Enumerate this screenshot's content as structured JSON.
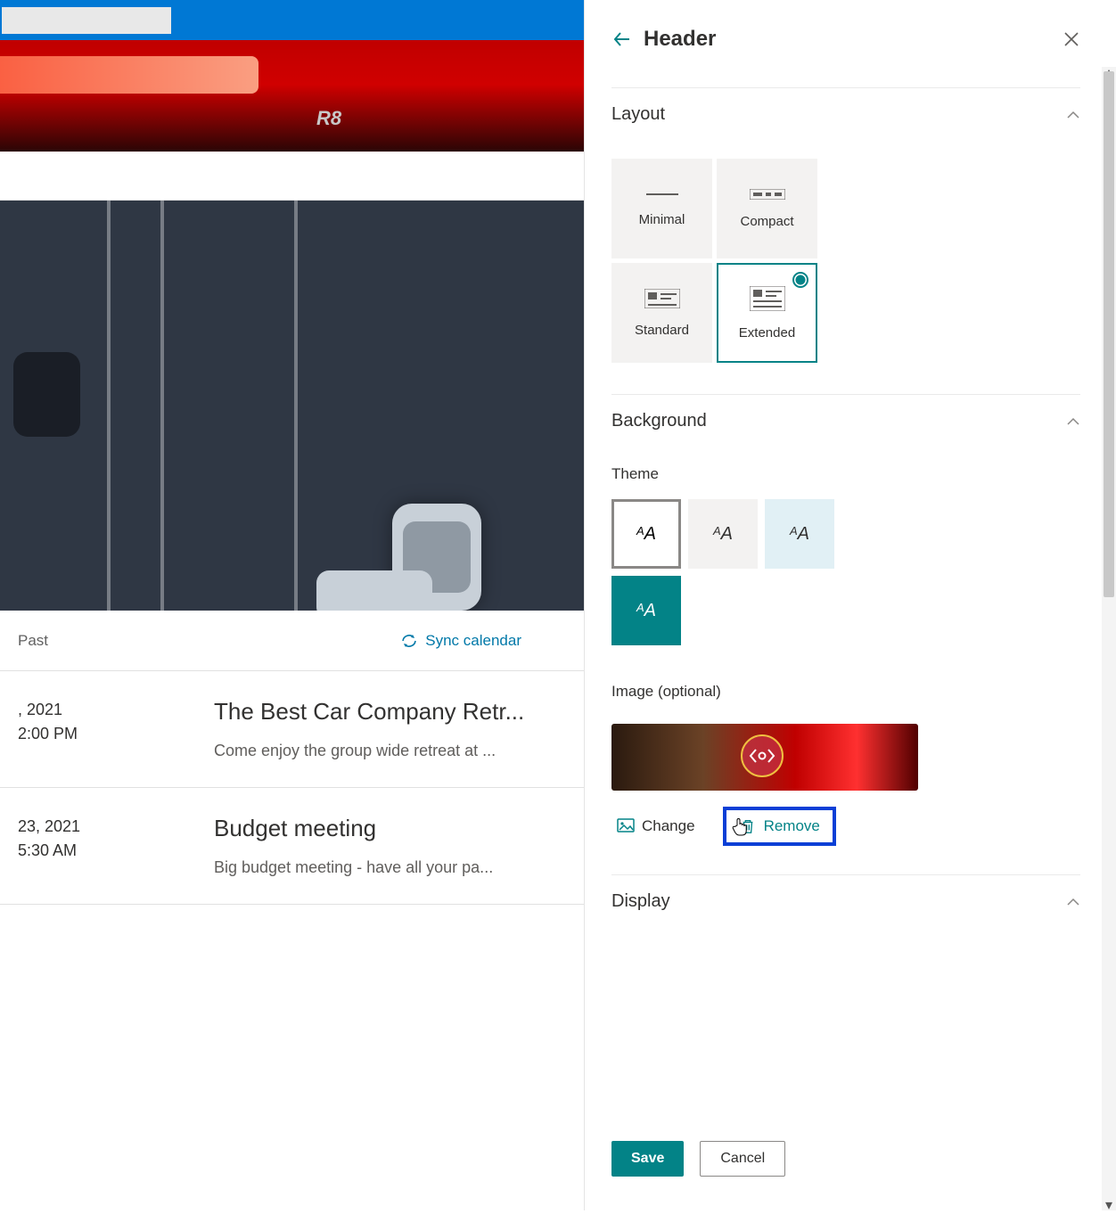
{
  "banner_badge": "R8",
  "events_header": {
    "past": "Past",
    "sync": "Sync calendar"
  },
  "events": [
    {
      "date_line1": ", 2021",
      "date_line2": "2:00 PM",
      "title": "The Best Car Company Retr...",
      "desc": "Come enjoy the group wide retreat at ..."
    },
    {
      "date_line1": "23, 2021",
      "date_line2": "5:30 AM",
      "title": "Budget meeting",
      "desc": "Big budget meeting - have all your pa..."
    }
  ],
  "panel": {
    "title": "Header",
    "sections": {
      "layout": "Layout",
      "background": "Background",
      "display": "Display"
    },
    "layout_options": {
      "minimal": "Minimal",
      "compact": "Compact",
      "standard": "Standard",
      "extended": "Extended"
    },
    "theme_label": "Theme",
    "image_label": "Image (optional)",
    "actions": {
      "change": "Change",
      "remove": "Remove"
    },
    "buttons": {
      "save": "Save",
      "cancel": "Cancel"
    }
  }
}
